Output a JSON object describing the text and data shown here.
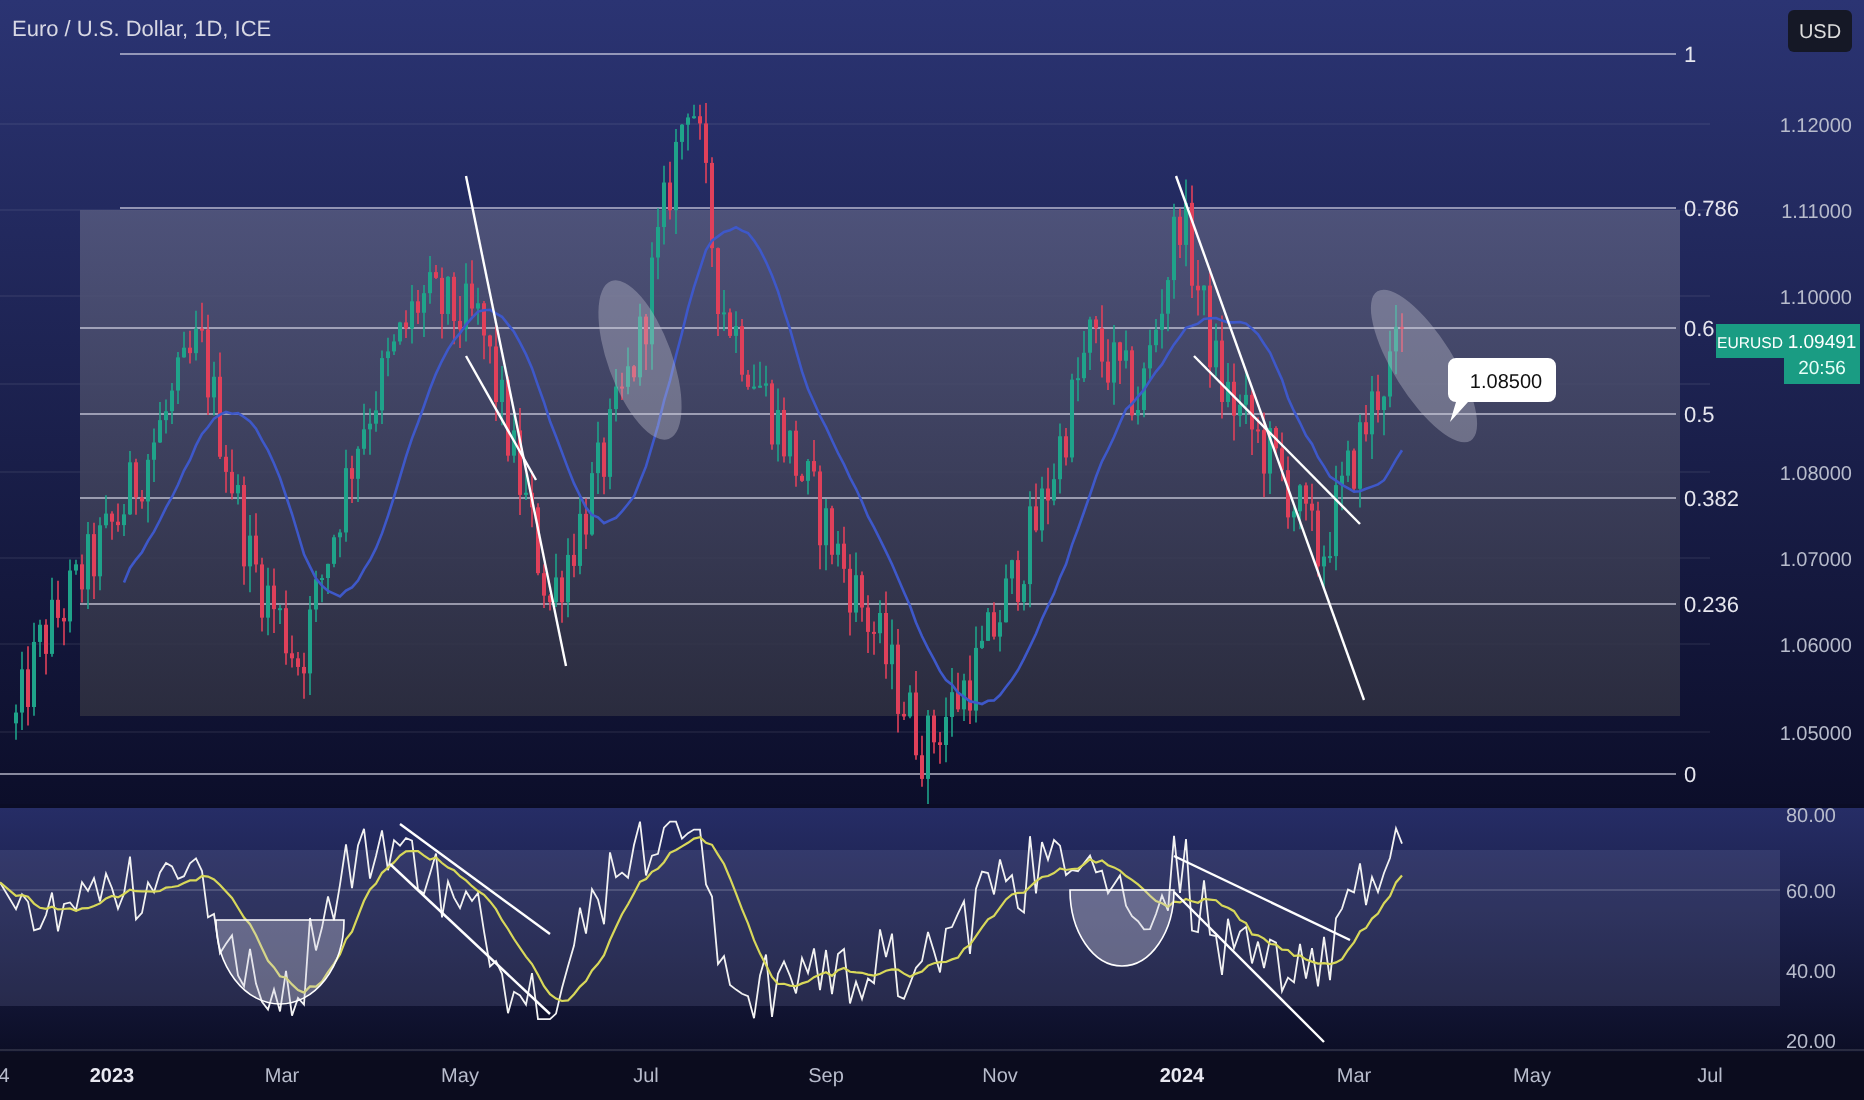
{
  "chart_title": "Euro / U.S. Dollar, 1D, ICE",
  "currency_button": "USD",
  "fib_levels": [
    {
      "label": "1"
    },
    {
      "label": "0.786"
    },
    {
      "label": "0.6"
    },
    {
      "label": "0.5"
    },
    {
      "label": "0.382"
    },
    {
      "label": "0.236"
    },
    {
      "label": "0"
    }
  ],
  "price_axis": [
    "1.12000",
    "1.11000",
    "1.10000",
    "1.08000",
    "1.07000",
    "1.06000",
    "1.05000"
  ],
  "symbol_tag": {
    "symbol": "EURUSD",
    "price": "1.09491",
    "countdown": "20:56"
  },
  "callout": "1.08500",
  "rsi_axis": [
    "80.00",
    "60.00",
    "40.00",
    "20.00"
  ],
  "time_axis": [
    {
      "label": "4",
      "kind": "month"
    },
    {
      "label": "2023",
      "kind": "year"
    },
    {
      "label": "Mar",
      "kind": "month"
    },
    {
      "label": "May",
      "kind": "month"
    },
    {
      "label": "Jul",
      "kind": "month"
    },
    {
      "label": "Sep",
      "kind": "month"
    },
    {
      "label": "Nov",
      "kind": "month"
    },
    {
      "label": "2024",
      "kind": "year"
    },
    {
      "label": "Mar",
      "kind": "month"
    },
    {
      "label": "May",
      "kind": "month"
    },
    {
      "label": "Jul",
      "kind": "month"
    }
  ]
}
